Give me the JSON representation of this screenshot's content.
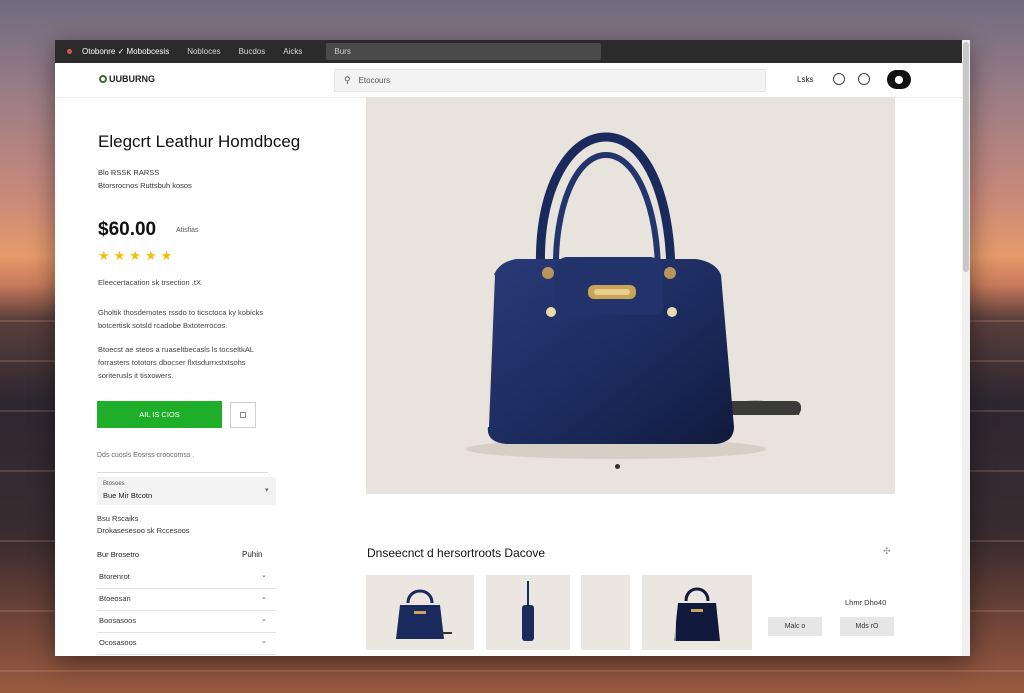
{
  "browser": {
    "tabs": [
      "Otobonre ✓ Mobobcesis",
      "Nobloces",
      "Bucdos",
      "Aicks"
    ],
    "address": "Burs"
  },
  "header": {
    "logo_text": "UUBURNG",
    "search_placeholder": "Etocours",
    "link_text": "Lsks"
  },
  "product": {
    "title": "Elegcrt Leathur Homdbceg",
    "meta_line1": "Blo RSSK RARSS",
    "meta_line2": "Btorsrocnos Ruttsbuh kosos",
    "price": "$60.00",
    "price_note": "Atisfias",
    "stars": "★★★★★",
    "rating": 5,
    "note": "Eleecertacation sk trsection .tX",
    "para1": "Gholtik thosdemotes rssdo to ticsctoca ky kobicks botcertisk sotsld rcadobe Bxtoterrocos.",
    "para2": "Btoecst ae steos a ruaseltbecasls ls tocseltkAL forrasters tototors dbocser flxtsdurrxstxtsohs soriterusls it tisxowers.",
    "add_button": "AIL IS CIOS",
    "shipping_note": "Dds cuosls Eosrss croocomss .",
    "select_label": "Btosoes",
    "select_value": "Bue Mir Btcotn",
    "ship_title": "Bsu Rscaiks",
    "ship_sub": "Drokasesesoo sk Rccesoos",
    "accordion_head_left": "Bur Brosetro",
    "accordion_head_right": "Puhin",
    "accordion_items": [
      "Btorenrot",
      "Btoeosan",
      "Boosasoos",
      "Ocosasoos"
    ]
  },
  "related": {
    "title": "Dnseecnct d hersortroots Dacove",
    "total_label": "Lhmr Dho40",
    "button1": "Malc o",
    "button2": "Mds rO"
  },
  "colors": {
    "accent": "#1fae2a",
    "bag_navy": "#1b2a5c",
    "star": "#f2c200"
  }
}
